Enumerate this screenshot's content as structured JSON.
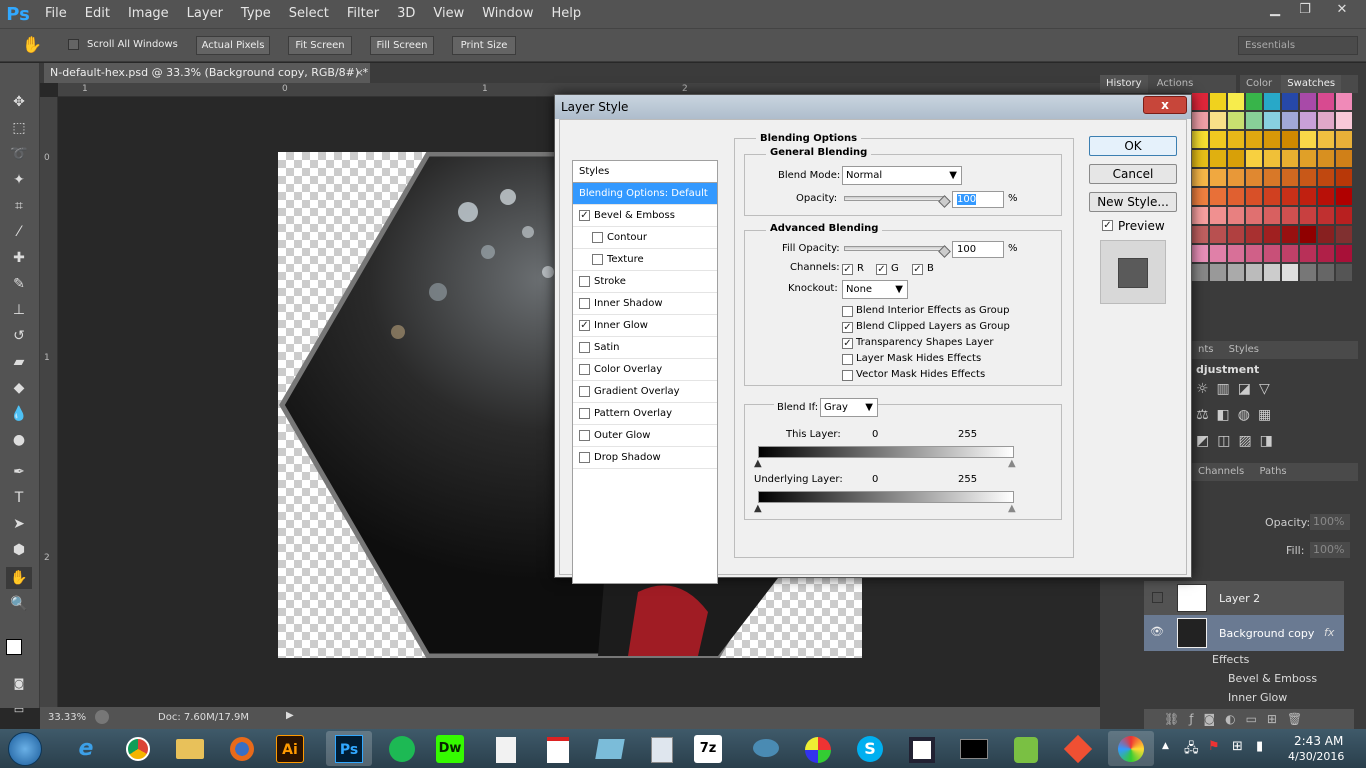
{
  "app": {
    "logo": "Ps"
  },
  "menu": [
    "File",
    "Edit",
    "Image",
    "Layer",
    "Type",
    "Select",
    "Filter",
    "3D",
    "View",
    "Window",
    "Help"
  ],
  "window_controls": {
    "minimize": "▁",
    "restore": "❐",
    "close": "✕"
  },
  "options_bar": {
    "scroll_all": "Scroll All Windows",
    "actual_pixels": "Actual Pixels",
    "fit_screen": "Fit Screen",
    "fill_screen": "Fill Screen",
    "print_size": "Print Size",
    "workspace": "Essentials"
  },
  "document": {
    "tab_title": "N-default-hex.psd @ 33.3% (Background copy, RGB/8#) *",
    "close": "×"
  },
  "rulers": {
    "h": [
      "1",
      "0",
      "1",
      "2"
    ],
    "v": [
      "0",
      "1",
      "2"
    ]
  },
  "status": {
    "zoom": "33.33%",
    "doc": "Doc: 7.60M/17.9M"
  },
  "panels": {
    "history_tab": "History",
    "actions_tab": "Actions",
    "color_tab": "Color",
    "swatches_tab": "Swatches",
    "adjust_tab": "nts",
    "styles_tab": "Styles",
    "adjust_title": "djustment",
    "channels_tab": "Channels",
    "paths_tab": "Paths",
    "opacity_label": "Opacity:",
    "opacity_value": "100%",
    "fill_label": "Fill:",
    "fill_value": "100%"
  },
  "layers": [
    {
      "name": "Layer 2"
    },
    {
      "name": "Background copy",
      "fx": "fx"
    }
  ],
  "effects": {
    "title": "Effects",
    "items": [
      "Bevel & Emboss",
      "Inner Glow"
    ]
  },
  "dialog": {
    "title": "Layer Style",
    "close": "x",
    "styles_header": "Styles",
    "style_items": [
      {
        "label": "Blending Options: Default",
        "checked": false,
        "selected": true,
        "checkbox": false,
        "indent": false
      },
      {
        "label": "Bevel & Emboss",
        "checked": true,
        "selected": false,
        "checkbox": true,
        "indent": false
      },
      {
        "label": "Contour",
        "checked": false,
        "selected": false,
        "checkbox": true,
        "indent": true
      },
      {
        "label": "Texture",
        "checked": false,
        "selected": false,
        "checkbox": true,
        "indent": true
      },
      {
        "label": "Stroke",
        "checked": false,
        "selected": false,
        "checkbox": true,
        "indent": false
      },
      {
        "label": "Inner Shadow",
        "checked": false,
        "selected": false,
        "checkbox": true,
        "indent": false
      },
      {
        "label": "Inner Glow",
        "checked": true,
        "selected": false,
        "checkbox": true,
        "indent": false
      },
      {
        "label": "Satin",
        "checked": false,
        "selected": false,
        "checkbox": true,
        "indent": false
      },
      {
        "label": "Color Overlay",
        "checked": false,
        "selected": false,
        "checkbox": true,
        "indent": false
      },
      {
        "label": "Gradient Overlay",
        "checked": false,
        "selected": false,
        "checkbox": true,
        "indent": false
      },
      {
        "label": "Pattern Overlay",
        "checked": false,
        "selected": false,
        "checkbox": true,
        "indent": false
      },
      {
        "label": "Outer Glow",
        "checked": false,
        "selected": false,
        "checkbox": true,
        "indent": false
      },
      {
        "label": "Drop Shadow",
        "checked": false,
        "selected": false,
        "checkbox": true,
        "indent": false
      }
    ],
    "blending_options": "Blending Options",
    "general_blending": "General Blending",
    "blend_mode_label": "Blend Mode:",
    "blend_mode_value": "Normal",
    "opacity_label": "Opacity:",
    "opacity_value": "100",
    "percent": "%",
    "advanced_blending": "Advanced Blending",
    "fill_opacity_label": "Fill Opacity:",
    "fill_opacity_value": "100",
    "channels_label": "Channels:",
    "channels": [
      {
        "label": "R",
        "checked": true
      },
      {
        "label": "G",
        "checked": true
      },
      {
        "label": "B",
        "checked": true
      }
    ],
    "knockout_label": "Knockout:",
    "knockout_value": "None",
    "advanced_checks": [
      {
        "label": "Blend Interior Effects as Group",
        "checked": false
      },
      {
        "label": "Blend Clipped Layers as Group",
        "checked": true
      },
      {
        "label": "Transparency Shapes Layer",
        "checked": true
      },
      {
        "label": "Layer Mask Hides Effects",
        "checked": false
      },
      {
        "label": "Vector Mask Hides Effects",
        "checked": false
      }
    ],
    "blend_if_label": "Blend If:",
    "blend_if_value": "Gray",
    "this_layer_label": "This Layer:",
    "underlying_layer_label": "Underlying Layer:",
    "range_min": "0",
    "range_max": "255",
    "ok": "OK",
    "cancel": "Cancel",
    "new_style": "New Style...",
    "preview_label": "Preview",
    "preview_checked": true
  },
  "taskbar": {
    "apps": [
      "e",
      "Ai",
      "Ps",
      "Dw",
      "7z",
      "S"
    ],
    "time": "2:43 AM",
    "date": "4/30/2016"
  },
  "colors": {
    "accent": "#3399ff",
    "ps_blue": "#31a8ff",
    "panel": "#535353",
    "dark": "#282828"
  }
}
